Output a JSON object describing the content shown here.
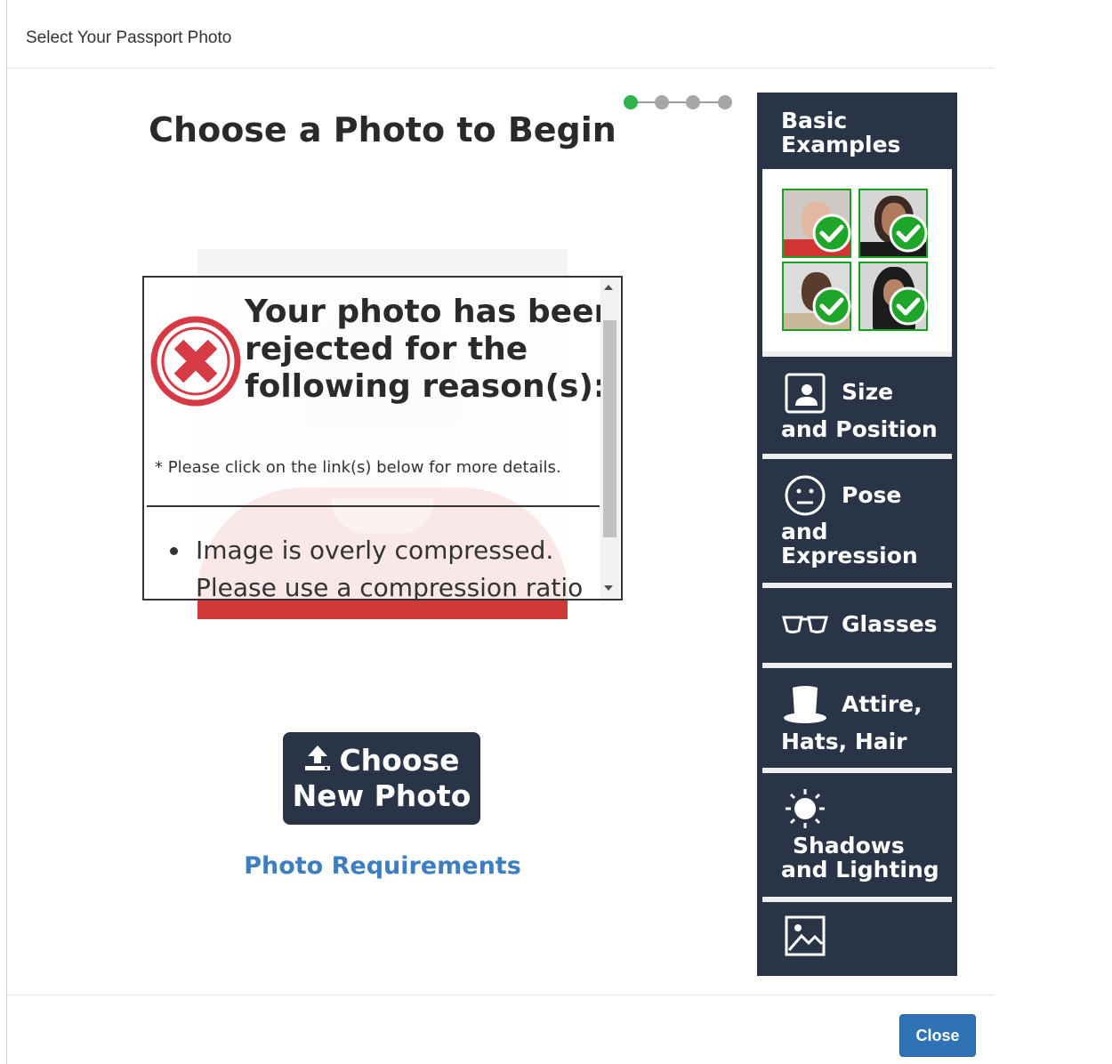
{
  "modal": {
    "title": "Select Your Passport Photo"
  },
  "progress": {
    "current_step": 1,
    "total_steps": 4
  },
  "main": {
    "heading": "Choose a Photo to Begin",
    "rejection": {
      "title": "Your photo has been rejected for the following reason(s):",
      "note": "* Please click on the link(s) below for more details.",
      "reason": "Image is overly compressed. Please use a compression ratio"
    },
    "choose_button": {
      "line1": "Choose",
      "line2": "New Photo",
      "icon": "upload-icon"
    },
    "requirements_link": "Photo Requirements"
  },
  "sidebar": {
    "basic_examples": {
      "line1": "Basic",
      "line2": "Examples"
    },
    "items": [
      {
        "line1": "Size",
        "line2": "and Position",
        "icon": "portrait-icon"
      },
      {
        "line1": "Pose",
        "line2": "and",
        "line3": "Expression",
        "icon": "neutral-face-icon"
      },
      {
        "line1": "Glasses",
        "icon": "glasses-icon"
      },
      {
        "line1": "Attire,",
        "line2": "Hats, Hair",
        "icon": "hat-icon"
      },
      {
        "line1": "Shadows",
        "line2": "and Lighting",
        "icon": "sun-icon"
      },
      {
        "icon": "image-icon"
      }
    ]
  },
  "footer": {
    "close_label": "Close"
  },
  "colors": {
    "dark_navy": "#2a3447",
    "accent_blue": "#2f73b5",
    "link_blue": "#3d7ebf",
    "active_green": "#2db34a",
    "reject_red": "#d63a45"
  }
}
